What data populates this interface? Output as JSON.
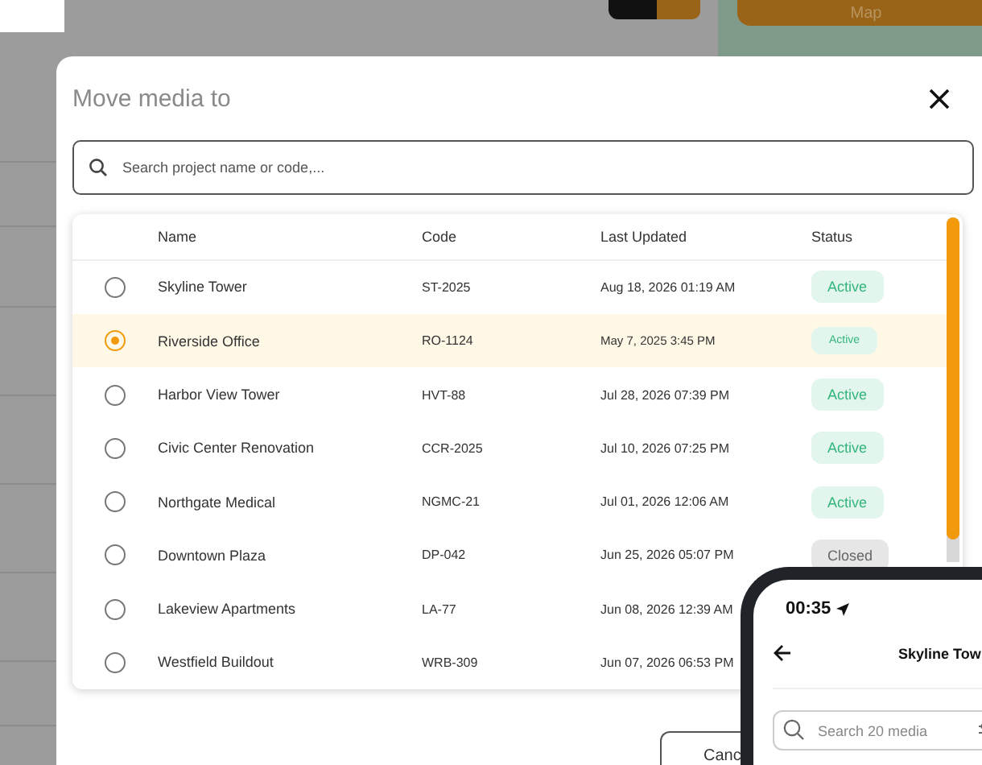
{
  "backdrop": {
    "map_button": "Map"
  },
  "dialog": {
    "title": "Move media to",
    "search": {
      "placeholder": "Search project name or code,..."
    },
    "columns": [
      "Name",
      "Code",
      "Last Updated",
      "Status"
    ],
    "rows": [
      {
        "name": "Skyline Tower",
        "code": "ST-2025",
        "updated": "Aug 18, 2026 01:19 AM",
        "status": "Active",
        "kind": "active",
        "selected": false
      },
      {
        "name": "Riverside Office",
        "code": "RO-1124",
        "updated": "May 7, 2025 3:45 PM",
        "status": "Active",
        "kind": "active",
        "selected": true
      },
      {
        "name": "Harbor View Tower",
        "code": "HVT-88",
        "updated": "Jul 28, 2026 07:39 PM",
        "status": "Active",
        "kind": "active",
        "selected": false
      },
      {
        "name": "Civic Center Renovation",
        "code": "CCR-2025",
        "updated": "Jul 10, 2026 07:25 PM",
        "status": "Active",
        "kind": "active",
        "selected": false
      },
      {
        "name": "Northgate Medical",
        "code": "NGMC-21",
        "updated": "Jul 01, 2026 12:06 AM",
        "status": "Active",
        "kind": "active",
        "selected": false
      },
      {
        "name": "Downtown Plaza",
        "code": "DP-042",
        "updated": "Jun 25, 2026 05:07 PM",
        "status": "Closed",
        "kind": "closed",
        "selected": false
      },
      {
        "name": "Lakeview Apartments",
        "code": "LA-77",
        "updated": "Jun 08, 2026 12:39 AM",
        "status": "",
        "kind": "none",
        "selected": false
      },
      {
        "name": "Westfield Buildout",
        "code": "WRB-309",
        "updated": "Jun 07, 2026 06:53 PM",
        "status": "",
        "kind": "none",
        "selected": false
      }
    ],
    "cancel_button": "Canc"
  },
  "phone": {
    "time": "00:35",
    "title": "Skyline Tow",
    "search": {
      "placeholder": "Search 20 media"
    }
  }
}
